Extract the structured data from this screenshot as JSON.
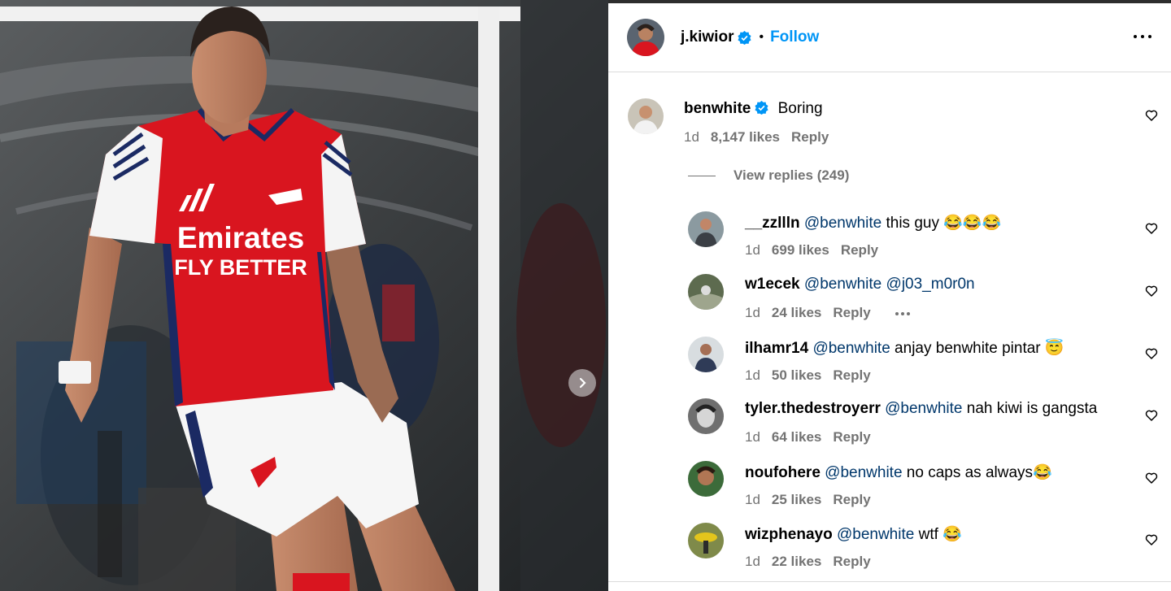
{
  "post": {
    "username": "j.kiwior",
    "separator": "•",
    "follow_label": "Follow",
    "photo_text": {
      "sponsor_line1": "Emirates",
      "sponsor_line2": "FLY BETTER"
    }
  },
  "comment_main": {
    "username": "benwhite",
    "text": "Boring",
    "time": "1d",
    "likes": "8,147 likes",
    "reply": "Reply"
  },
  "view_replies": "View replies (249)",
  "replies": [
    {
      "username": "__zzllln",
      "mention": "@benwhite",
      "text": " this guy 😂😂😂",
      "time": "1d",
      "likes": "699 likes",
      "reply": "Reply"
    },
    {
      "username": "w1ecek",
      "mention": "@benwhite",
      "mention2": "@j03_m0r0n",
      "time": "1d",
      "likes": "24 likes",
      "reply": "Reply"
    },
    {
      "username": "ilhamr14",
      "mention": "@benwhite",
      "text": " anjay benwhite pintar 😇",
      "time": "1d",
      "likes": "50 likes",
      "reply": "Reply"
    },
    {
      "username": "tyler.thedestroyerr",
      "mention": "@benwhite",
      "text": " nah kiwi is gangsta",
      "time": "1d",
      "likes": "64 likes",
      "reply": "Reply"
    },
    {
      "username": "noufohere",
      "mention": "@benwhite",
      "text": " no caps as always😂",
      "time": "1d",
      "likes": "25 likes",
      "reply": "Reply"
    },
    {
      "username": "wizphenayo",
      "mention": "@benwhite",
      "text": " wtf 😂",
      "time": "1d",
      "likes": "22 likes",
      "reply": "Reply"
    }
  ],
  "icons": {
    "verified": "verified-badge-icon",
    "heart": "heart-outline-icon",
    "more": "more-options-icon",
    "next": "chevron-right-icon"
  },
  "colors": {
    "link_blue": "#0095f6",
    "mention_blue": "#00376b",
    "secondary_text": "#737373",
    "verified": "#0095f6",
    "arsenal_red": "#d9151f"
  }
}
